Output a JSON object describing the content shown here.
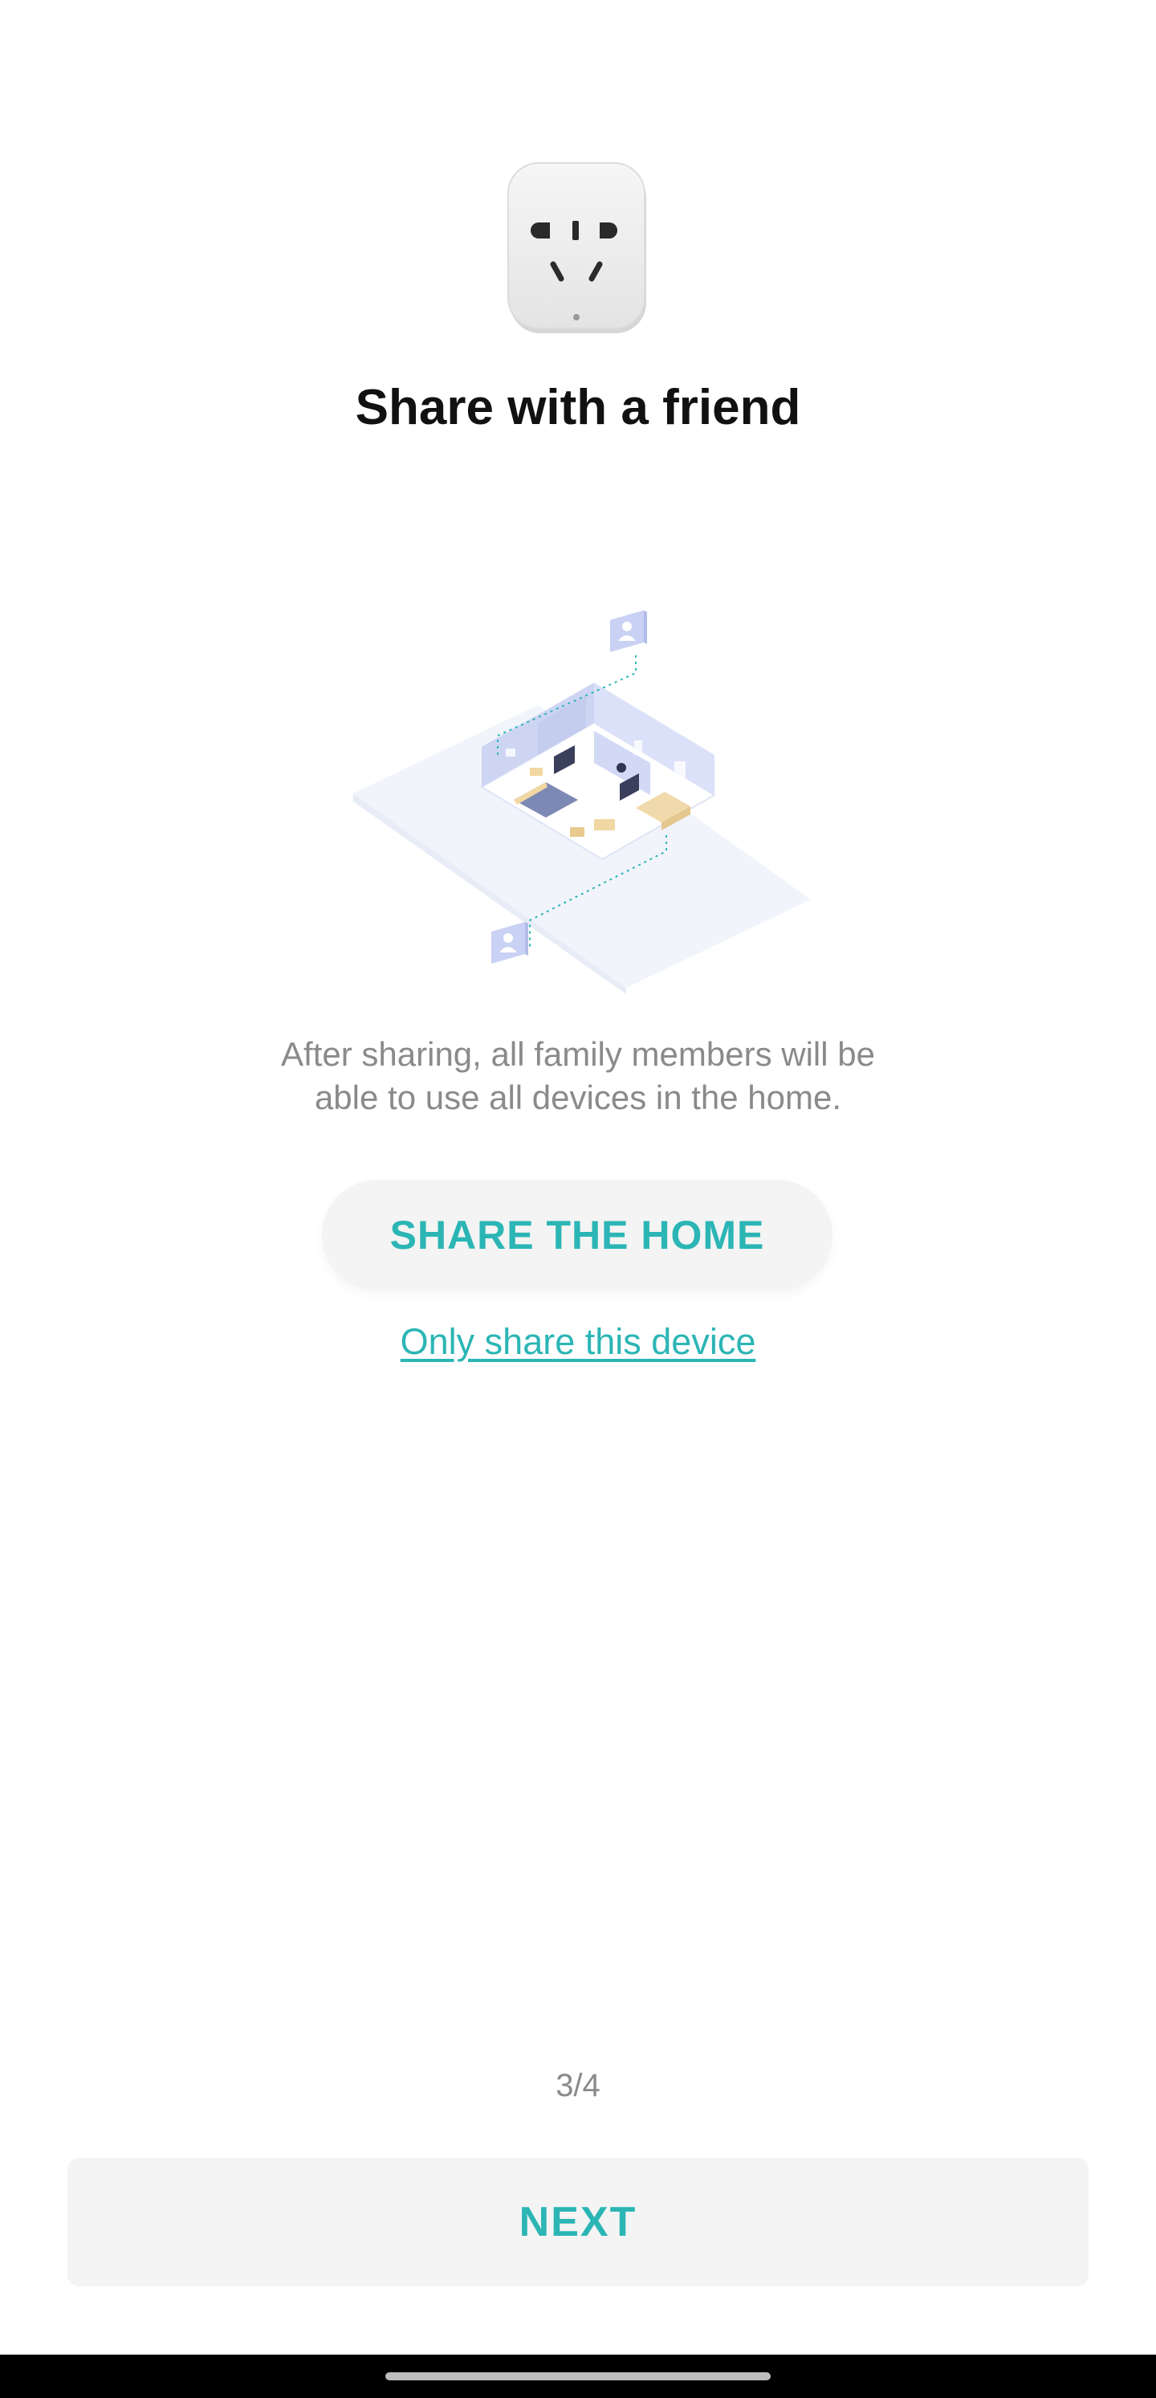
{
  "header": {
    "title": "Share with a friend",
    "device_icon": "smart-plug-icon"
  },
  "main": {
    "illustration_icon": "home-sharing-illustration",
    "description_line1": "After sharing, all family members will be",
    "description_line2": "able to use all devices in the home.",
    "share_home_label": "SHARE THE HOME",
    "share_device_label": "Only share this device"
  },
  "footer": {
    "pager": "3/4",
    "next_label": "NEXT"
  },
  "colors": {
    "accent": "#2cb5b5",
    "button_bg": "#f4f4f4",
    "secondary_text": "#8a8a8a"
  }
}
